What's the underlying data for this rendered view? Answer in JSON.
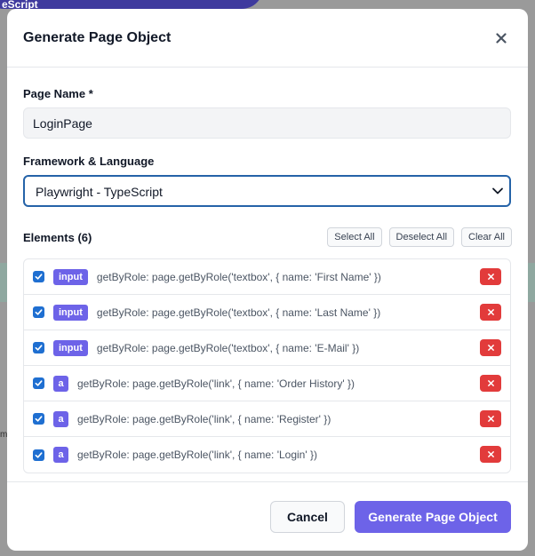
{
  "background": {
    "pill_text": "eScript",
    "fragment_text": "m"
  },
  "modal": {
    "title": "Generate Page Object",
    "close_icon": "close-icon"
  },
  "page_name": {
    "label": "Page Name *",
    "value": "LoginPage"
  },
  "framework": {
    "label": "Framework & Language",
    "selected": "Playwright - TypeScript"
  },
  "elements": {
    "title_prefix": "Elements",
    "count_text": "(6)",
    "select_all": "Select All",
    "deselect_all": "Deselect All",
    "clear_all": "Clear All",
    "items": [
      {
        "checked": true,
        "tag": "input",
        "locator": "getByRole: page.getByRole('textbox', { name: 'First Name' })"
      },
      {
        "checked": true,
        "tag": "input",
        "locator": "getByRole: page.getByRole('textbox', { name: 'Last Name' })"
      },
      {
        "checked": true,
        "tag": "input",
        "locator": "getByRole: page.getByRole('textbox', { name: 'E-Mail' })"
      },
      {
        "checked": true,
        "tag": "a",
        "locator": "getByRole: page.getByRole('link', { name: 'Order History' })"
      },
      {
        "checked": true,
        "tag": "a",
        "locator": "getByRole: page.getByRole('link', { name: 'Register' })"
      },
      {
        "checked": true,
        "tag": "a",
        "locator": "getByRole: page.getByRole('link', { name: 'Login' })"
      }
    ]
  },
  "footer": {
    "cancel": "Cancel",
    "generate": "Generate Page Object"
  },
  "colors": {
    "accent": "#6d63e8",
    "checkbox": "#1f6fd1",
    "danger": "#e23b3b",
    "select_border": "#2563a8"
  }
}
